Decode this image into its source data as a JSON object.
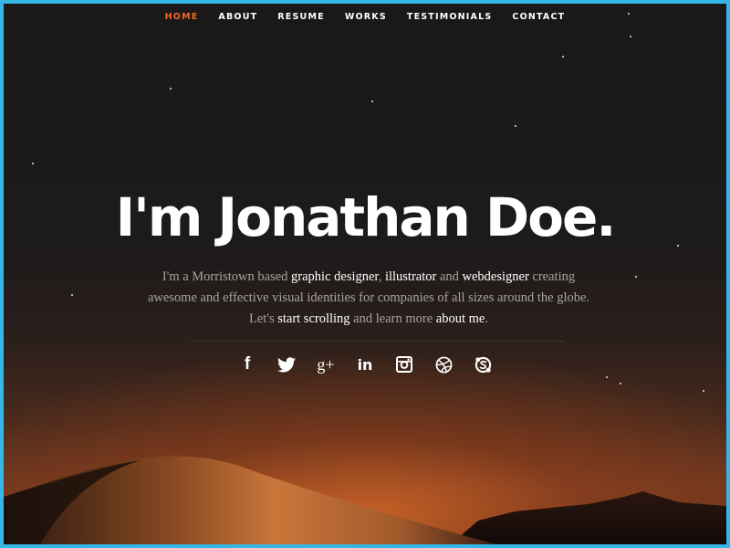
{
  "nav": {
    "items": [
      {
        "label": "HOME",
        "active": true
      },
      {
        "label": "ABOUT",
        "active": false
      },
      {
        "label": "RESUME",
        "active": false
      },
      {
        "label": "WORKS",
        "active": false
      },
      {
        "label": "TESTIMONIALS",
        "active": false
      },
      {
        "label": "CONTACT",
        "active": false
      }
    ],
    "active_color": "#f06a2c"
  },
  "hero": {
    "title": "I'm Jonathan Doe.",
    "text": {
      "part1": "I'm a Morristown based ",
      "link1": "graphic designer",
      "part2": ", ",
      "link2": "illustrator",
      "part3": " and ",
      "link3": "webdesigner",
      "part4": " creating awesome and effective visual identities for companies of all sizes around the globe. Let's ",
      "link4": "start scrolling",
      "part5": " and learn more ",
      "link5": "about me",
      "part6": "."
    }
  },
  "social": {
    "icons": [
      "facebook-icon",
      "twitter-icon",
      "google-plus-icon",
      "linkedin-icon",
      "instagram-icon",
      "dribbble-icon",
      "skype-icon"
    ],
    "labels": {
      "facebook": "f",
      "linkedin": "in",
      "google_plus": "g+"
    }
  },
  "colors": {
    "accent": "#f06a2c",
    "border": "#34b7e6",
    "text_muted": "#a9a39e"
  }
}
